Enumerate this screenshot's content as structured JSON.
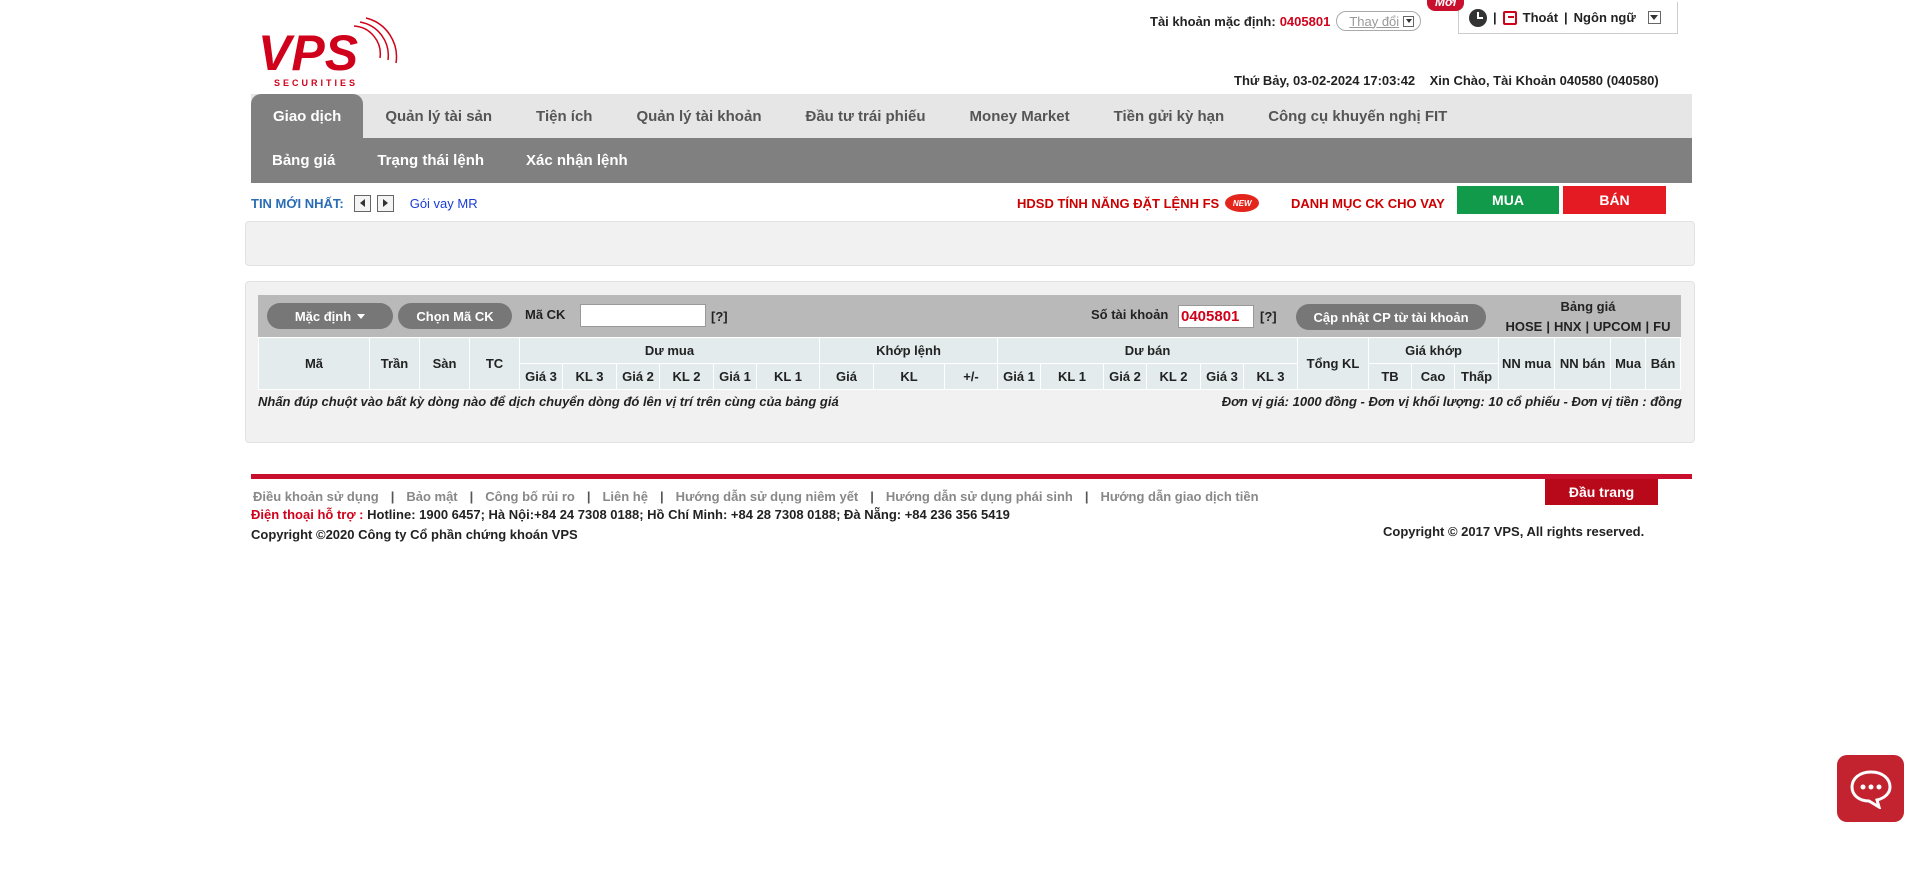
{
  "brand": {
    "name": "VPS",
    "tagline": "SECURITIES",
    "color": "#d0021b"
  },
  "header": {
    "default_account_label": "Tài khoản mặc định:",
    "default_account_number": "0405801",
    "change_label": "Thay đổi",
    "logout_label": "Thoát",
    "language_label": "Ngôn ngữ",
    "datetime": "Thứ Bảy, 03-02-2024 17:03:42",
    "greeting": "Xin Chào, Tài Khoản 040580 (040580)"
  },
  "mainnav": {
    "items": [
      "Giao dịch",
      "Quản lý tài sản",
      "Tiện ích",
      "Quản lý tài khoản",
      "Đầu tư trái phiếu",
      "Money Market",
      "Tiền gửi kỳ hạn",
      "Công cụ khuyến nghị FIT"
    ],
    "active_index": 0,
    "new_badge": "Mới"
  },
  "subnav": {
    "items": [
      "Bảng giá",
      "Trạng thái lệnh",
      "Xác nhận lệnh"
    ]
  },
  "news": {
    "label": "TIN MỚI NHẤT:",
    "link": "Gói vay MR",
    "hdsd": "HDSD TÍNH NĂNG ĐẶT LỆNH FS",
    "new_tag": "NEW",
    "danhmuc": "DANH MỤC CK CHO VAY",
    "buy": "MUA",
    "sell": "BÁN"
  },
  "board": {
    "default_btn": "Mặc định",
    "choose_btn": "Chọn Mã CK",
    "code_label": "Mã CK",
    "code_value": "",
    "help": "[?]",
    "account_label": "Số tài khoản",
    "account_value": "0405801",
    "update_btn": "Cập nhật CP từ tài khoản",
    "price_board_label": "Bảng giá",
    "exchanges": [
      "HOSE",
      "HNX",
      "UPCOM",
      "FU"
    ],
    "columns": {
      "ma": "Mã",
      "tran": "Trần",
      "san": "Sàn",
      "tc": "TC",
      "du_mua": "Dư mua",
      "khop_lenh": "Khớp lệnh",
      "du_ban": "Dư bán",
      "tong_kl": "Tổng KL",
      "gia_khop": "Giá khớp",
      "nn_mua": "NN mua",
      "nn_ban": "NN bán",
      "mua": "Mua",
      "ban": "Bán",
      "du_mua_sub": [
        "Giá 3",
        "KL 3",
        "Giá 2",
        "KL 2",
        "Giá 1",
        "KL 1"
      ],
      "khop_sub": [
        "Giá",
        "KL",
        "+/-"
      ],
      "du_ban_sub": [
        "Giá 1",
        "KL 1",
        "Giá 2",
        "KL 2",
        "Giá 3",
        "KL 3"
      ],
      "gia_khop_sub": [
        "TB",
        "Cao",
        "Thấp"
      ]
    },
    "note_left": "Nhấn đúp chuột vào bất kỳ dòng nào để dịch chuyển dòng đó lên vị trí trên cùng của bảng giá",
    "note_right": "Đơn vị giá: 1000 đồng - Đơn vị khối lượng: 10 cổ phiếu - Đơn vị tiền : đồng"
  },
  "footer": {
    "links": [
      "Điều khoản sử dụng",
      "Bảo mật",
      "Công bố rủi ro",
      "Liên hệ",
      "Hướng dẫn sử dụng niêm yết",
      "Hướng dẫn sử dụng phái sinh",
      "Hướng dẫn giao dịch tiền"
    ],
    "top_btn": "Đầu trang",
    "support_label": "Điện thoại hỗ trợ :",
    "support_text": "Hotline: 1900 6457; Hà Nội:+84 24 7308 0188; Hồ Chí Minh: +84 28 7308 0188; Đà Nẵng: +84 236 356 5419",
    "copyright_left": "Copyright ©2020 Công ty Cổ phần chứng khoán VPS",
    "copyright_right": "Copyright © 2017 VPS, All rights reserved."
  }
}
